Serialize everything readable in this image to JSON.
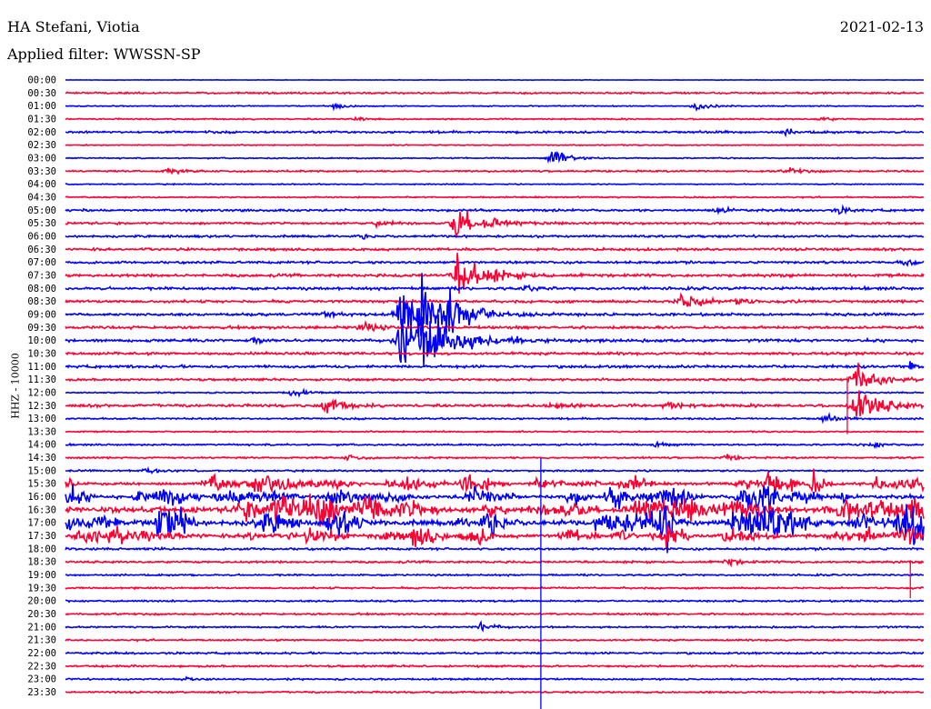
{
  "header": {
    "station": "HA Stefani, Viotia",
    "date": "2021-02-13",
    "filter_label": "Applied filter: WWSSN-SP"
  },
  "chart_data": {
    "type": "line",
    "subtype": "helicorder",
    "title": "HA Stefani, Viotia",
    "ylabel": "HHZ - 10000",
    "minutes_per_row": 30,
    "colors": [
      "#0000ff",
      "#ff0033"
    ],
    "row_labels": [
      "00:00",
      "00:30",
      "01:00",
      "01:30",
      "02:00",
      "02:30",
      "03:00",
      "03:30",
      "04:00",
      "04:30",
      "05:00",
      "05:30",
      "06:00",
      "06:30",
      "07:00",
      "07:30",
      "08:00",
      "08:30",
      "09:00",
      "09:30",
      "10:00",
      "10:30",
      "11:00",
      "11:30",
      "12:00",
      "12:30",
      "13:00",
      "13:30",
      "14:00",
      "14:30",
      "15:00",
      "15:30",
      "16:00",
      "16:30",
      "17:00",
      "17:30",
      "18:00",
      "18:30",
      "19:00",
      "19:30",
      "20:00",
      "20:30",
      "21:00",
      "21:30",
      "22:00",
      "22:30",
      "23:00",
      "23:30"
    ],
    "noise": [
      0.3,
      1,
      0.6,
      0.8,
      1.2,
      0.6,
      0.7,
      1,
      0.6,
      0.8,
      1.3,
      1.3,
      1.3,
      1.4,
      1.4,
      1.6,
      1.6,
      1.5,
      1.5,
      1.5,
      1.6,
      1.5,
      1.5,
      1.3,
      0.8,
      1.6,
      1,
      0.8,
      1,
      1,
      1,
      1.5,
      2,
      3,
      3,
      2,
      1.3,
      1.2,
      1,
      1,
      1,
      1,
      1,
      1,
      1.1,
      1.1,
      1,
      1
    ],
    "events": [
      [
        2,
        9.4,
        5
      ],
      [
        2,
        22,
        6
      ],
      [
        3,
        10.2,
        3
      ],
      [
        3,
        26.4,
        3
      ],
      [
        4,
        25.2,
        4
      ],
      [
        6,
        17,
        12
      ],
      [
        7,
        3.6,
        4
      ],
      [
        7,
        25.3,
        4
      ],
      [
        10,
        22.8,
        4
      ],
      [
        10,
        27,
        4
      ],
      [
        11,
        10.9,
        4
      ],
      [
        11,
        13.6,
        25
      ],
      [
        12,
        10.4,
        3
      ],
      [
        14,
        29.3,
        5
      ],
      [
        15,
        13.7,
        30
      ],
      [
        16,
        16.1,
        4
      ],
      [
        17,
        21.5,
        14
      ],
      [
        17,
        23.4,
        5
      ],
      [
        18,
        9,
        5
      ],
      [
        18,
        11.7,
        40
      ],
      [
        18,
        12.3,
        30
      ],
      [
        18,
        13.4,
        20
      ],
      [
        19,
        10.4,
        8
      ],
      [
        20,
        11.7,
        40
      ],
      [
        20,
        12.6,
        30
      ],
      [
        20,
        15.5,
        5
      ],
      [
        20,
        6.6,
        4
      ],
      [
        22,
        29.5,
        5
      ],
      [
        23,
        27.6,
        20
      ],
      [
        24,
        7.9,
        6
      ],
      [
        25,
        9.1,
        12
      ],
      [
        25,
        27.6,
        25
      ],
      [
        25,
        17,
        6
      ],
      [
        25,
        21,
        6
      ],
      [
        26,
        26.5,
        5
      ],
      [
        28,
        20.6,
        4
      ],
      [
        28,
        28.2,
        4
      ],
      [
        29,
        9.9,
        4
      ],
      [
        29,
        23.1,
        4
      ],
      [
        30,
        2.8,
        4
      ],
      [
        37,
        23.1,
        5
      ],
      [
        42,
        14.5,
        6
      ],
      [
        46,
        4.3,
        3
      ]
    ],
    "active_rows": [
      31,
      32,
      33,
      34,
      35
    ],
    "spikes": [
      [
        30,
        16.6,
        280
      ],
      [
        37,
        29.5,
        40
      ],
      [
        23,
        27.3,
        60
      ]
    ]
  }
}
